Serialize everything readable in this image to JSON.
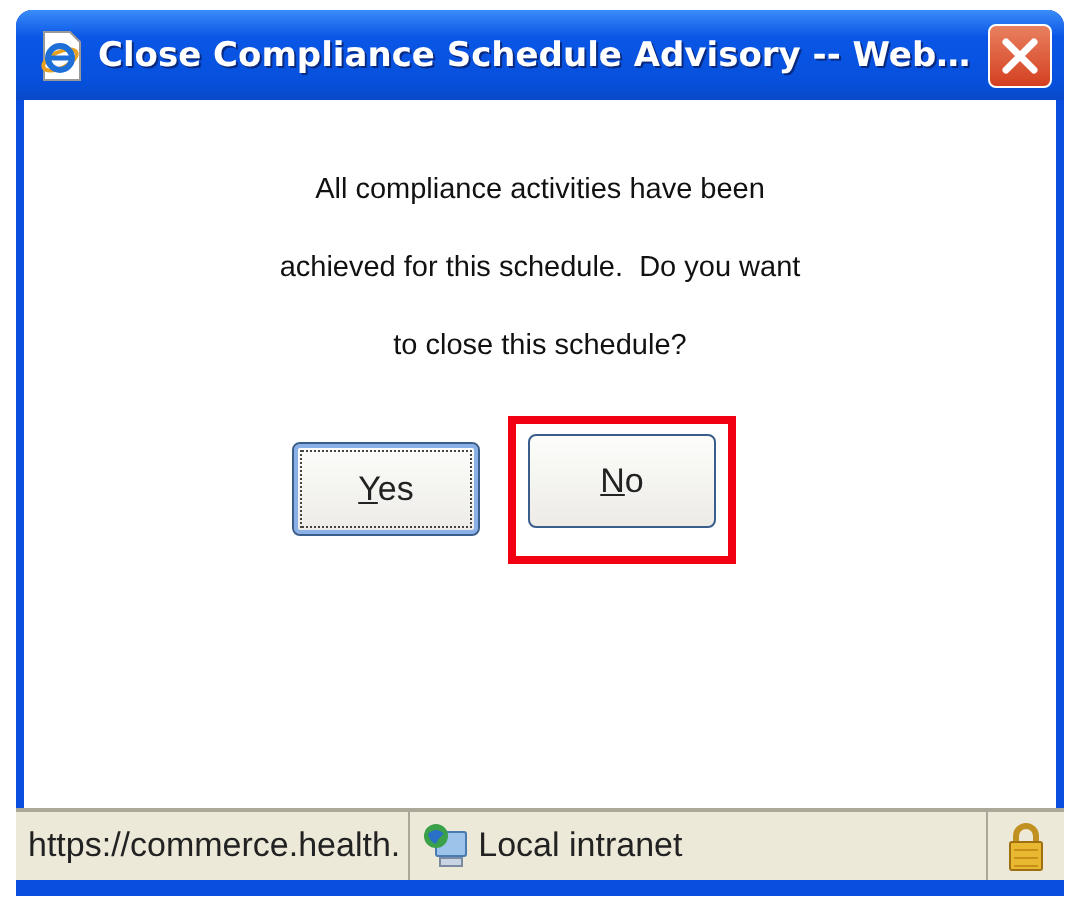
{
  "window": {
    "title": "Close Compliance Schedule Advisory -- Web…"
  },
  "message": [
    "All compliance activities have been",
    "achieved for this schedule.  Do you want",
    "to close this schedule?"
  ],
  "buttons": [
    {
      "label": "Yes",
      "mnemonic": true,
      "focused": true,
      "highlighted": false
    },
    {
      "label": "No",
      "mnemonic": true,
      "focused": false,
      "highlighted": true
    }
  ],
  "status_bar": {
    "url": "https://commerce.health.",
    "zone": "Local intranet",
    "secure": true
  }
}
